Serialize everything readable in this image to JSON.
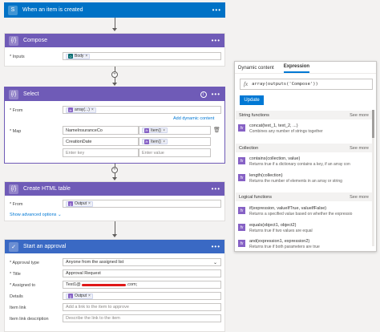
{
  "trigger": {
    "title": "When an item is created"
  },
  "compose": {
    "title": "Compose",
    "inputs_label": "* Inputs",
    "token": "Body"
  },
  "select": {
    "title": "Select",
    "from_label": "* From",
    "from_token": "array(...)",
    "add_dynamic": "Add dynamic content",
    "map_label": "* Map",
    "rows": [
      {
        "key": "NameInsuranceCo",
        "value": "Item()"
      },
      {
        "key": "CreationDate",
        "value": "Item()"
      }
    ],
    "enter_key": "Enter key",
    "enter_value": "Enter value"
  },
  "html_table": {
    "title": "Create HTML table",
    "from_label": "* From",
    "token": "Output",
    "advanced": "Show advanced options"
  },
  "approval": {
    "title": "Start an approval",
    "fields": [
      {
        "label": "* Approval type",
        "value": "Anyone from the assigned list"
      },
      {
        "label": "* Title",
        "value": "Approval Request"
      },
      {
        "label": "* Assigned to",
        "value_prefix": "Test1@",
        "value_suffix": ".com;"
      },
      {
        "label": "Details",
        "token": "Output"
      },
      {
        "label": "Item link",
        "placeholder": "Add a link to the item to approve"
      },
      {
        "label": "Item link description",
        "placeholder": "Describe the link to the item"
      }
    ]
  },
  "panel": {
    "tabs": [
      "Dynamic content",
      "Expression"
    ],
    "expression": "array(outputs('Compose'))",
    "update": "Update",
    "sections": [
      {
        "title": "String functions",
        "more": "See more",
        "items": [
          {
            "name": "concat(text_1, text_2, ...)",
            "desc": "Combines any number of strings together"
          }
        ]
      },
      {
        "title": "Collection",
        "more": "See more",
        "items": [
          {
            "name": "contains(collection, value)",
            "desc": "Returns true if a dictionary contains a key, if an array con"
          },
          {
            "name": "length(collection)",
            "desc": "Returns the number of elements in an array or string"
          }
        ]
      },
      {
        "title": "Logical functions",
        "more": "See more",
        "items": [
          {
            "name": "if(expression, valueIfTrue, valueIfFalse)",
            "desc": "Returns a specified value based on whether the expressio"
          },
          {
            "name": "equals(object1, object2)",
            "desc": "Returns true if two values are equal"
          },
          {
            "name": "and(expression1, expression2)",
            "desc": "Returns true if both parameters are true"
          }
        ]
      }
    ]
  },
  "colors": {
    "trigger": "#0072c6",
    "compose": "#6f5bb7",
    "approval": "#3a69c4",
    "accent": "#0078d4"
  }
}
